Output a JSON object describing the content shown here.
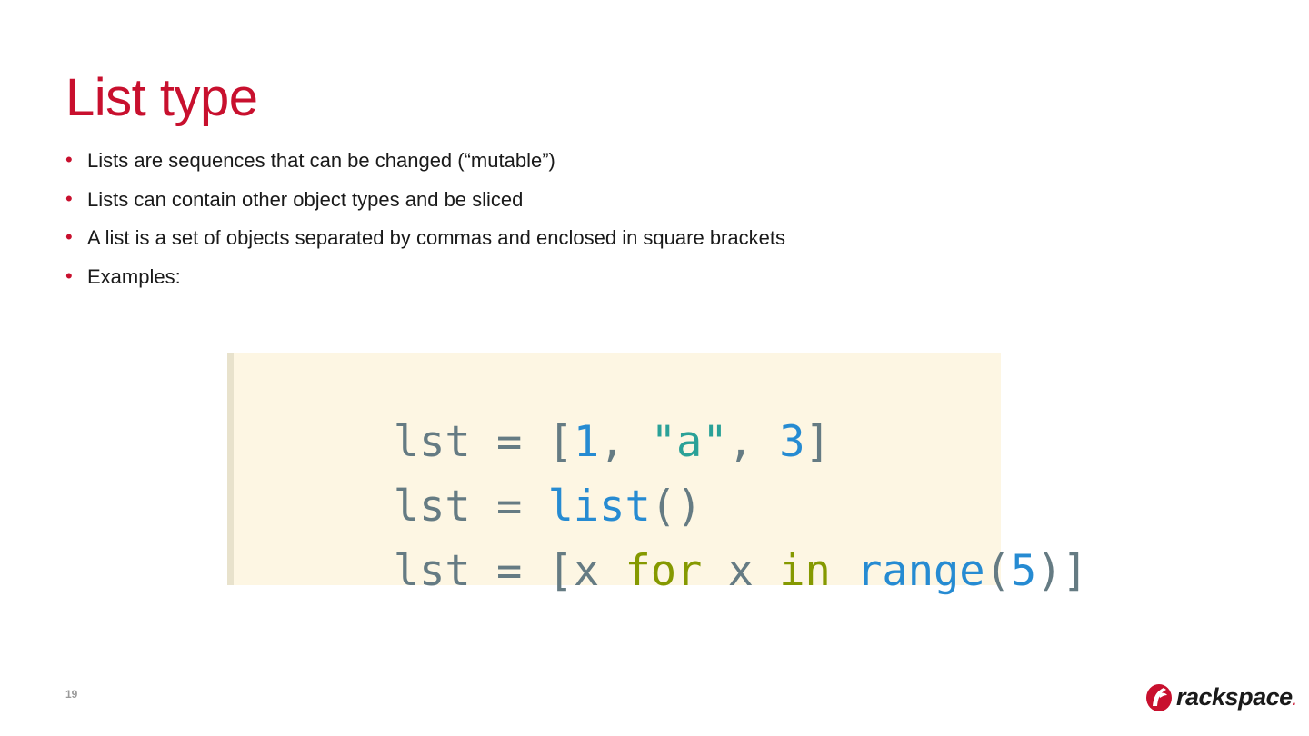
{
  "slide": {
    "title": "List type",
    "bullets": [
      "Lists are sequences that can be changed (“mutable”)",
      "Lists can contain other object types and be sliced",
      "A list is a set of objects separated by commas and enclosed in square brackets",
      "Examples:"
    ],
    "page_number": "19"
  },
  "code": {
    "lines": [
      [
        {
          "text": "lst = [",
          "kind": "plain"
        },
        {
          "text": "1",
          "kind": "num"
        },
        {
          "text": ", ",
          "kind": "plain"
        },
        {
          "text": "\"a\"",
          "kind": "str"
        },
        {
          "text": ", ",
          "kind": "plain"
        },
        {
          "text": "3",
          "kind": "num"
        },
        {
          "text": "]",
          "kind": "plain"
        }
      ],
      [
        {
          "text": "lst = ",
          "kind": "plain"
        },
        {
          "text": "list",
          "kind": "fn"
        },
        {
          "text": "()",
          "kind": "plain"
        }
      ],
      [
        {
          "text": "lst = [x ",
          "kind": "plain"
        },
        {
          "text": "for",
          "kind": "kw"
        },
        {
          "text": " x ",
          "kind": "plain"
        },
        {
          "text": "in",
          "kind": "kw"
        },
        {
          "text": " ",
          "kind": "plain"
        },
        {
          "text": "range",
          "kind": "fn"
        },
        {
          "text": "(",
          "kind": "plain"
        },
        {
          "text": "5",
          "kind": "num"
        },
        {
          "text": ")]",
          "kind": "plain"
        }
      ]
    ]
  },
  "logo": {
    "word": "rackspace",
    "trademark": ".",
    "icon": "rackspace-logo-icon",
    "color_primary": "#c8102e"
  },
  "colors": {
    "title": "#c8102e",
    "bullet": "#c8102e",
    "code_background": "#fdf6e3",
    "code_plain": "#657b83",
    "code_number": "#268bd2",
    "code_string": "#2aa198",
    "code_keyword": "#859900"
  }
}
